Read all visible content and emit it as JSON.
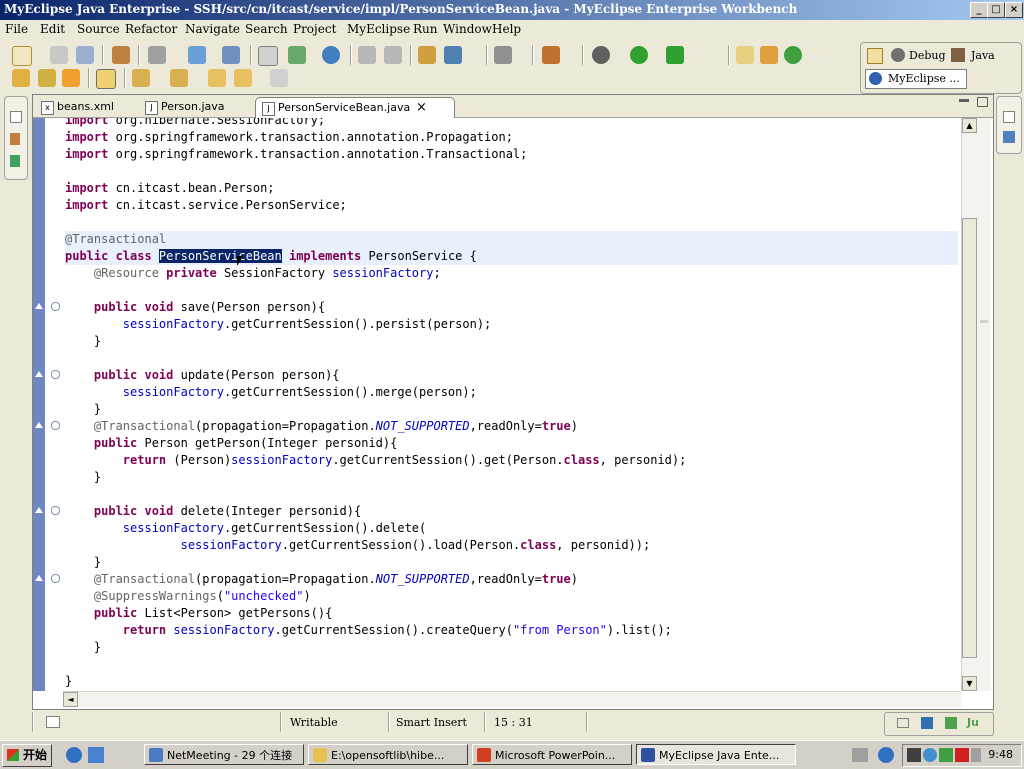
{
  "window": {
    "title": "MyEclipse Java Enterprise - SSH/src/cn/itcast/service/impl/PersonServiceBean.java - MyEclipse Enterprise Workbench",
    "controls": [
      "_",
      "□",
      "×"
    ]
  },
  "menu": [
    "File",
    "Edit",
    "Source",
    "Refactor",
    "Navigate",
    "Search",
    "Project",
    "MyEclipse",
    "Run",
    "Window",
    "Help"
  ],
  "perspectives": {
    "debug": "Debug",
    "java": "Java",
    "myeclipse": "MyEclipse ..."
  },
  "tabs": [
    {
      "label": "beans.xml",
      "icon": "x",
      "active": false
    },
    {
      "label": "Person.java",
      "icon": "J",
      "active": false
    },
    {
      "label": "PersonServiceBean.java",
      "icon": "J",
      "active": true
    }
  ],
  "tab_close": "×",
  "code": [
    [
      [
        "import ",
        "kw"
      ],
      [
        "org.hibernate.SessionFactory;",
        ""
      ]
    ],
    [
      [
        "import ",
        "kw"
      ],
      [
        "org.springframework.transaction.annotation.Propagation;",
        ""
      ]
    ],
    [
      [
        "import ",
        "kw"
      ],
      [
        "org.springframework.transaction.annotation.Transactional;",
        ""
      ]
    ],
    [],
    [
      [
        "import ",
        "kw"
      ],
      [
        "cn.itcast.bean.Person;",
        ""
      ]
    ],
    [
      [
        "import ",
        "kw"
      ],
      [
        "cn.itcast.service.PersonService;",
        ""
      ]
    ],
    [],
    [
      [
        "@Transactional",
        "ann"
      ]
    ],
    [
      [
        "public class ",
        "kw"
      ],
      [
        "PersonServiceBean",
        "sel"
      ],
      [
        " ",
        ""
      ],
      [
        "implements ",
        "kw"
      ],
      [
        "PersonService {",
        ""
      ]
    ],
    [
      [
        "    @Resource ",
        "ann"
      ],
      [
        "private ",
        "kw"
      ],
      [
        "SessionFactory ",
        ""
      ],
      [
        "sessionFactory",
        "fld"
      ],
      [
        ";",
        ""
      ]
    ],
    [],
    [
      [
        "    public void ",
        "kw"
      ],
      [
        "save(Person person){",
        ""
      ]
    ],
    [
      [
        "        sessionFactory",
        "fld"
      ],
      [
        ".getCurrentSession().persist(person);",
        ""
      ]
    ],
    [
      [
        "    }",
        ""
      ]
    ],
    [],
    [
      [
        "    public void ",
        "kw"
      ],
      [
        "update(Person person){",
        ""
      ]
    ],
    [
      [
        "        sessionFactory",
        "fld"
      ],
      [
        ".getCurrentSession().merge(person);",
        ""
      ]
    ],
    [
      [
        "    }",
        ""
      ]
    ],
    [
      [
        "    @Transactional",
        "ann"
      ],
      [
        "(propagation=Propagation.",
        ""
      ],
      [
        "NOT_SUPPORTED",
        "stat"
      ],
      [
        ",readOnly=",
        ""
      ],
      [
        "true",
        "kw"
      ],
      [
        ")",
        ""
      ]
    ],
    [
      [
        "    public ",
        "kw"
      ],
      [
        "Person getPerson(Integer personid){",
        ""
      ]
    ],
    [
      [
        "        return ",
        "kw"
      ],
      [
        "(Person)",
        ""
      ],
      [
        "sessionFactory",
        "fld"
      ],
      [
        ".getCurrentSession().get(Person.",
        ""
      ],
      [
        "class",
        "kw"
      ],
      [
        ", personid);",
        ""
      ]
    ],
    [
      [
        "    }",
        ""
      ]
    ],
    [],
    [
      [
        "    public void ",
        "kw"
      ],
      [
        "delete(Integer personid){",
        ""
      ]
    ],
    [
      [
        "        sessionFactory",
        "fld"
      ],
      [
        ".getCurrentSession().delete(",
        ""
      ]
    ],
    [
      [
        "                sessionFactory",
        "fld"
      ],
      [
        ".getCurrentSession().load(Person.",
        ""
      ],
      [
        "class",
        "kw"
      ],
      [
        ", personid));",
        ""
      ]
    ],
    [
      [
        "    }",
        ""
      ]
    ],
    [
      [
        "    @Transactional",
        "ann"
      ],
      [
        "(propagation=Propagation.",
        ""
      ],
      [
        "NOT_SUPPORTED",
        "stat"
      ],
      [
        ",readOnly=",
        ""
      ],
      [
        "true",
        "kw"
      ],
      [
        ")",
        ""
      ]
    ],
    [
      [
        "    @SuppressWarnings",
        "ann"
      ],
      [
        "(",
        ""
      ],
      [
        "\"unchecked\"",
        "str"
      ],
      [
        ")",
        ""
      ]
    ],
    [
      [
        "    public ",
        "kw"
      ],
      [
        "List<Person> getPersons(){",
        ""
      ]
    ],
    [
      [
        "        return ",
        "kw"
      ],
      [
        "sessionFactory",
        "fld"
      ],
      [
        ".getCurrentSession().createQuery(",
        ""
      ],
      [
        "\"from Person\"",
        "str"
      ],
      [
        ").list();",
        ""
      ]
    ],
    [
      [
        "    }",
        ""
      ]
    ],
    [],
    [
      [
        "}",
        ""
      ]
    ]
  ],
  "status": {
    "writable": "Writable",
    "insert_mode": "Smart Insert",
    "position": "15 : 31"
  },
  "taskbar": {
    "start": "开始",
    "tasks": [
      {
        "label": "NetMeeting - 29 个连接",
        "color": "#4a7cc4"
      },
      {
        "label": "E:\\opensoftlib\\hibe...",
        "color": "#e8c050"
      },
      {
        "label": "Microsoft PowerPoin...",
        "color": "#d04020"
      },
      {
        "label": "MyEclipse Java Ente...",
        "color": "#3050a0"
      }
    ],
    "clock": "9:48"
  }
}
